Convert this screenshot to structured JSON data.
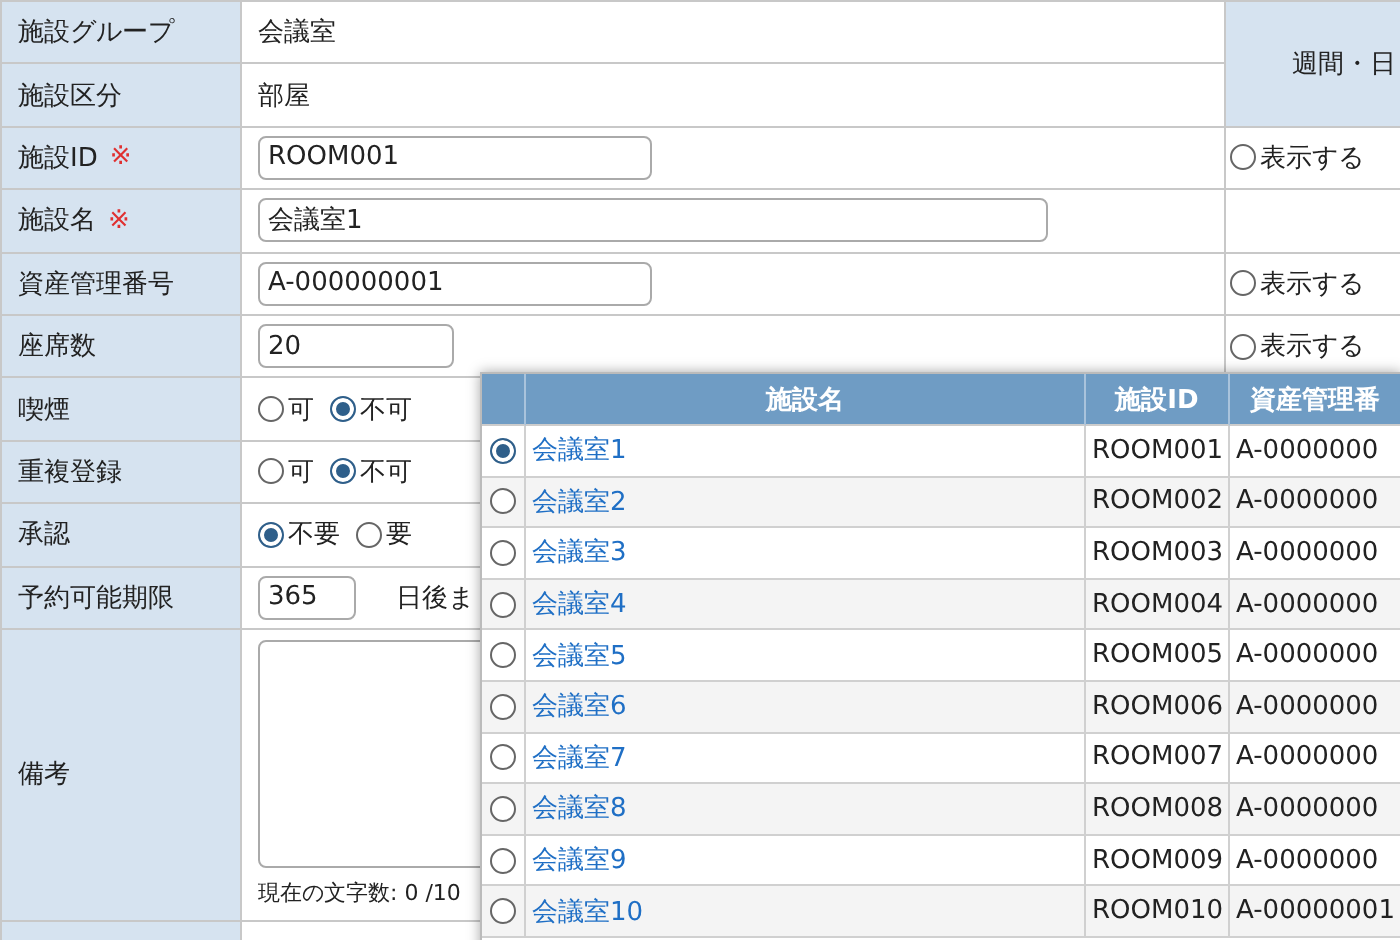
{
  "form": {
    "side_header": "週間・日",
    "rows": [
      {
        "label": "施設グループ",
        "kind": "text",
        "value": "会議室"
      },
      {
        "label": "施設区分",
        "kind": "text",
        "value": "部屋"
      },
      {
        "label": "施設ID",
        "required_mark": "※",
        "kind": "code_field",
        "value": "ROOM001",
        "display_option": {
          "label": "表示する",
          "selected": false
        }
      },
      {
        "label": "施設名",
        "required_mark": "※",
        "kind": "name_field",
        "value": "会議室1"
      },
      {
        "label": "資産管理番号",
        "kind": "code_field",
        "value": "A-000000001",
        "display_option": {
          "label": "表示する",
          "selected": false
        }
      },
      {
        "label": "座席数",
        "kind": "number_field",
        "value": "20",
        "display_option": {
          "label": "表示する",
          "selected": false
        }
      },
      {
        "label": "喫煙",
        "kind": "radio",
        "options": [
          {
            "label": "可",
            "selected": false
          },
          {
            "label": "不可",
            "selected": true
          }
        ]
      },
      {
        "label": "重複登録",
        "kind": "radio",
        "options": [
          {
            "label": "可",
            "selected": false
          },
          {
            "label": "不可",
            "selected": true
          }
        ]
      },
      {
        "label": "承認",
        "kind": "radio",
        "options": [
          {
            "label": "不要",
            "selected": true
          },
          {
            "label": "要",
            "selected": false
          }
        ]
      },
      {
        "label": "予約可能期限",
        "kind": "limit_field",
        "value": "365",
        "suffix": "日後ま"
      },
      {
        "label": "備考",
        "kind": "memo",
        "counter": "現在の文字数: 0 /10"
      },
      {
        "kind": "blank_field"
      }
    ]
  },
  "popup": {
    "columns": [
      "施設名",
      "施設ID",
      "資産管理番"
    ],
    "rows": [
      {
        "name": "会議室1",
        "id": "ROOM001",
        "asset": "A-0000000",
        "selected": true
      },
      {
        "name": "会議室2",
        "id": "ROOM002",
        "asset": "A-0000000",
        "selected": false
      },
      {
        "name": "会議室3",
        "id": "ROOM003",
        "asset": "A-0000000",
        "selected": false
      },
      {
        "name": "会議室4",
        "id": "ROOM004",
        "asset": "A-0000000",
        "selected": false
      },
      {
        "name": "会議室5",
        "id": "ROOM005",
        "asset": "A-0000000",
        "selected": false
      },
      {
        "name": "会議室6",
        "id": "ROOM006",
        "asset": "A-0000000",
        "selected": false
      },
      {
        "name": "会議室7",
        "id": "ROOM007",
        "asset": "A-0000000",
        "selected": false
      },
      {
        "name": "会議室8",
        "id": "ROOM008",
        "asset": "A-0000000",
        "selected": false
      },
      {
        "name": "会議室9",
        "id": "ROOM009",
        "asset": "A-0000000",
        "selected": false
      },
      {
        "name": "会議室10",
        "id": "ROOM010",
        "asset": "A-00000001",
        "selected": false
      }
    ]
  }
}
